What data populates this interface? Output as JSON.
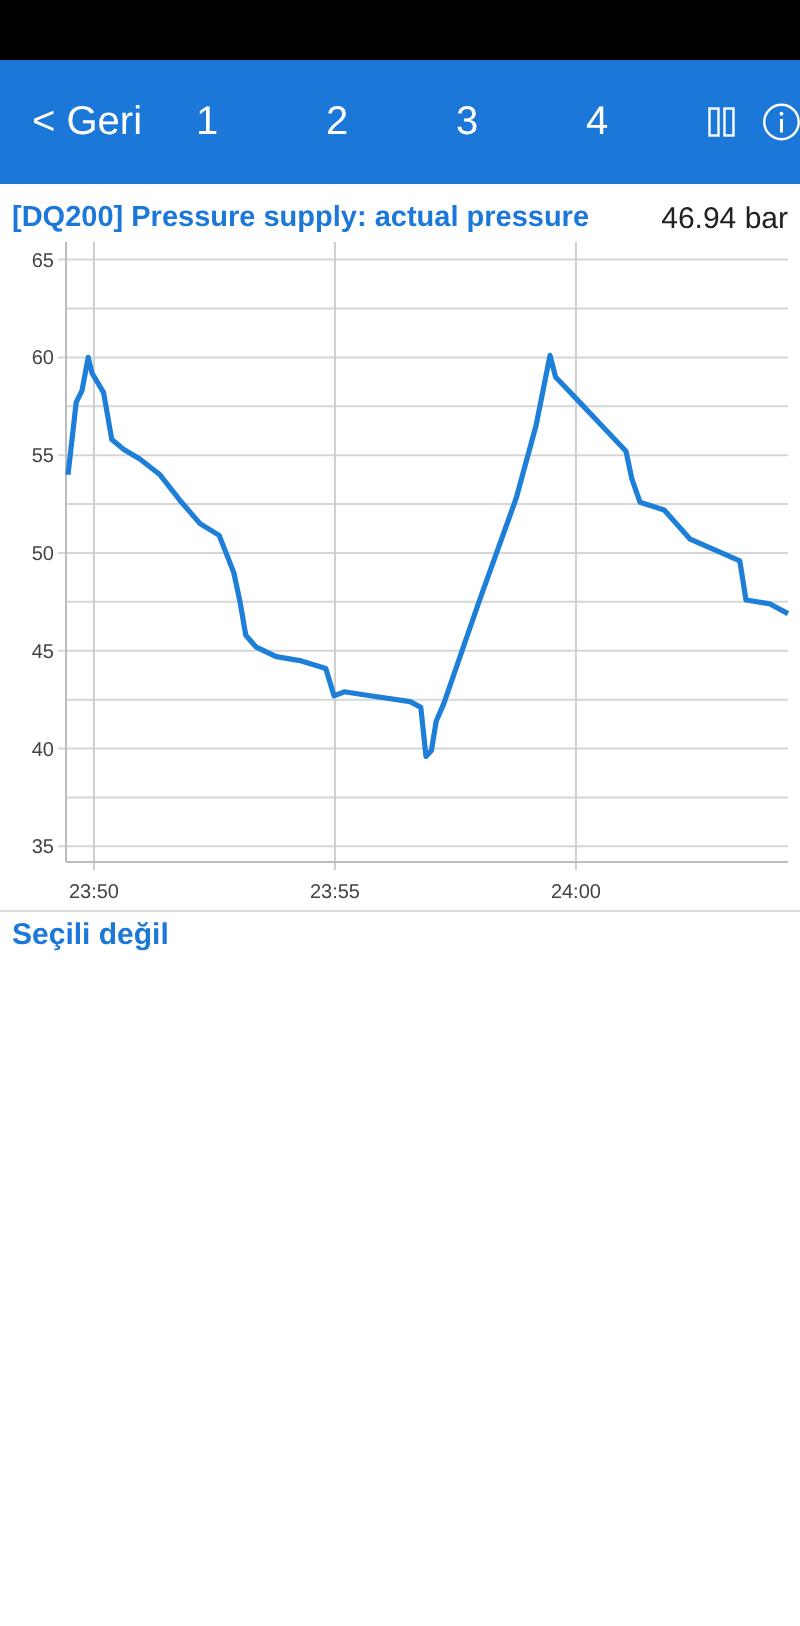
{
  "header": {
    "back": "< Geri",
    "tabs": [
      {
        "label": "1"
      },
      {
        "label": "2"
      },
      {
        "label": "3"
      },
      {
        "label": "4"
      }
    ]
  },
  "signal": {
    "title": "[DQ200] Pressure supply: actual pressure",
    "reading": "46.94 bar",
    "chart_data": {
      "type": "line",
      "grid": true,
      "xlim": [
        1429.42,
        1444.4
      ],
      "ylim": [
        34.2,
        65.9
      ],
      "xticks": [
        {
          "value": 1430,
          "label": "23:50"
        },
        {
          "value": 1435,
          "label": "23:55"
        },
        {
          "value": 1440,
          "label": "24:00"
        }
      ],
      "yticks": [
        35,
        40,
        45,
        50,
        55,
        60,
        65
      ],
      "series": [
        {
          "color": "#1e7fd8",
          "x": [
            1429.46,
            1429.63,
            1429.75,
            1429.88,
            1429.96,
            1430.2,
            1430.37,
            1430.62,
            1430.95,
            1431.37,
            1431.78,
            1432.2,
            1432.6,
            1432.9,
            1433.03,
            1433.15,
            1433.36,
            1433.78,
            1434.27,
            1434.81,
            1434.98,
            1435.19,
            1435.73,
            1436.56,
            1436.78,
            1436.89,
            1437.0,
            1437.1,
            1437.26,
            1438.0,
            1438.76,
            1439.17,
            1439.46,
            1439.58,
            1440.08,
            1440.5,
            1441.04,
            1441.16,
            1441.33,
            1441.83,
            1442.37,
            1443.4,
            1443.53,
            1444.02,
            1444.4
          ],
          "values": [
            54,
            57.7,
            58.3,
            60,
            59.2,
            58.2,
            55.8,
            55.3,
            54.8,
            54,
            52.7,
            51.5,
            50.9,
            49,
            47.5,
            45.8,
            45.2,
            44.7,
            44.5,
            44.1,
            42.7,
            42.9,
            42.7,
            42.4,
            42.1,
            39.6,
            39.9,
            41.4,
            42.3,
            47.6,
            52.8,
            56.5,
            60.1,
            59,
            57.7,
            56.6,
            55.2,
            53.8,
            52.6,
            52.2,
            50.7,
            49.6,
            47.6,
            47.4,
            46.9
          ]
        }
      ]
    }
  },
  "selection": "Seçili değil"
}
